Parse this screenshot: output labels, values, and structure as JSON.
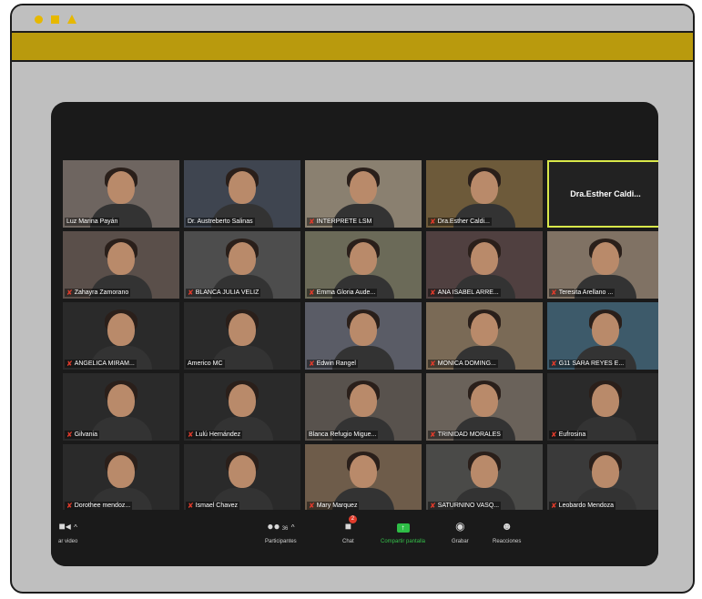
{
  "icons": {
    "circle": "circle-icon",
    "square": "square-icon",
    "triangle": "triangle-icon"
  },
  "colors": {
    "accent": "#b99a0d",
    "frame": "#bfbfbf",
    "dark": "#1a1a1a",
    "share_green": "#2ebd46",
    "mic_muted": "#e03b2b",
    "active_speaker": "#d9e84a"
  },
  "participants": [
    {
      "name": "Luz Marina Payán",
      "muted": false
    },
    {
      "name": "Dr. Austreberto Salinas",
      "muted": false
    },
    {
      "name": "INTERPRETE LSM",
      "muted": true
    },
    {
      "name": "Dra.Esther Caldi...",
      "muted": true
    },
    {
      "name": "Dra.Esther Caldi...",
      "muted": false,
      "active": true
    },
    {
      "name": "Zahayra Zamorano",
      "muted": true
    },
    {
      "name": "BLANCA JULIA VELIZ",
      "muted": true
    },
    {
      "name": "Emma Gloria Aude...",
      "muted": true
    },
    {
      "name": "ANA ISABEL ARRE...",
      "muted": true
    },
    {
      "name": "Teresita Arellano ...",
      "muted": true
    },
    {
      "name": "ANGELICA MIRAM...",
      "muted": true
    },
    {
      "name": "Americo MC",
      "muted": false
    },
    {
      "name": "Edwin Rangel",
      "muted": true
    },
    {
      "name": "MONICA DOMING...",
      "muted": true
    },
    {
      "name": "G11 SARA REYES E...",
      "muted": true
    },
    {
      "name": "Gilvania",
      "muted": true
    },
    {
      "name": "Lulú Hernández",
      "muted": true
    },
    {
      "name": "Blanca Refugio Migue...",
      "muted": false
    },
    {
      "name": "TRINIDAD MORALES",
      "muted": true
    },
    {
      "name": "Eufrosina",
      "muted": true
    },
    {
      "name": "Dorothee mendoz...",
      "muted": true
    },
    {
      "name": "Ismael Chavez",
      "muted": true
    },
    {
      "name": "Mary Marquez",
      "muted": true
    },
    {
      "name": "SATURNINO VASQ...",
      "muted": true
    },
    {
      "name": "Leobardo Mendoza",
      "muted": true
    }
  ],
  "toolbar": {
    "video_label": "ar video",
    "participants_label": "Participantes",
    "participants_count": "36",
    "chat_label": "Chat",
    "chat_badge": "2",
    "share_label": "Compartir pantalla",
    "record_label": "Grabar",
    "reactions_label": "Reacciones"
  }
}
